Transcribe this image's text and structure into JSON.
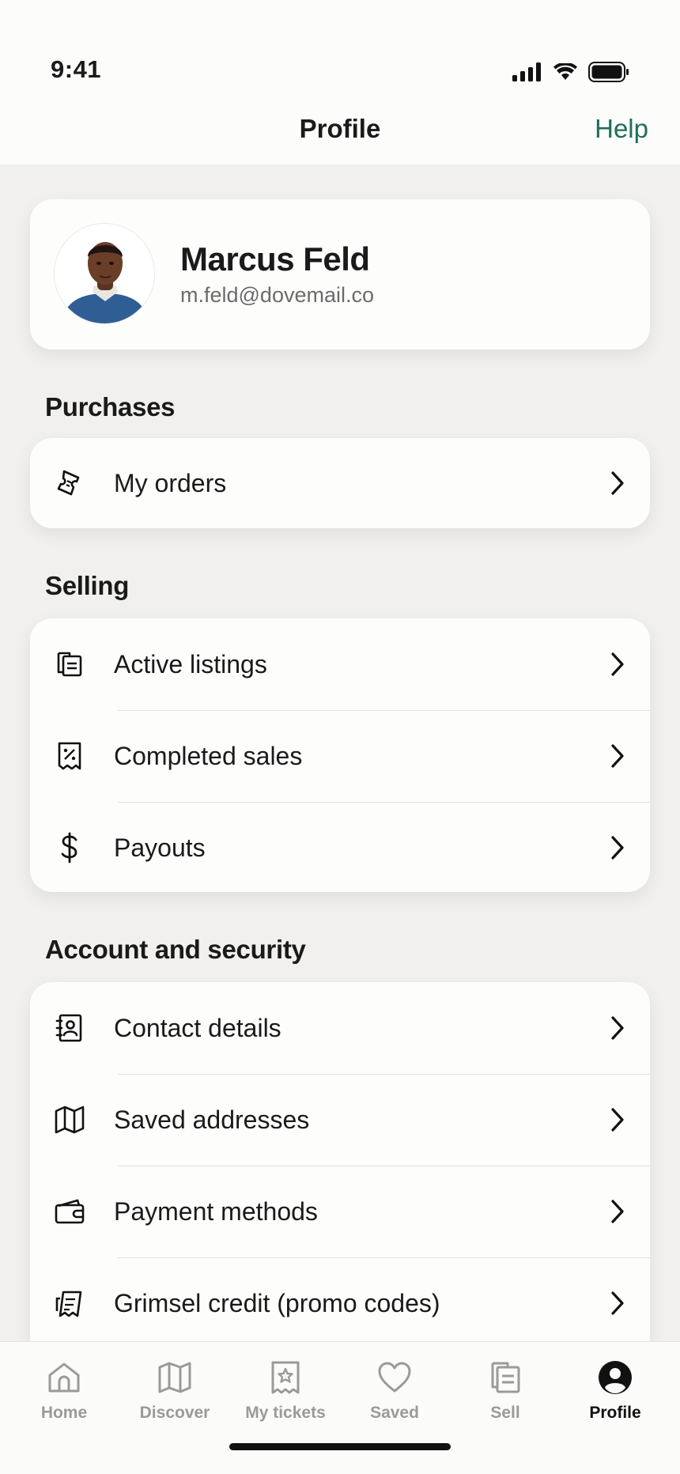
{
  "status_bar": {
    "time": "9:41"
  },
  "nav": {
    "title": "Profile",
    "help_label": "Help"
  },
  "profile": {
    "name": "Marcus Feld",
    "email": "m.feld@dovemail.co"
  },
  "sections": {
    "purchases": {
      "title": "Purchases",
      "items": [
        {
          "label": "My orders",
          "icon": "ticket-icon"
        }
      ]
    },
    "selling": {
      "title": "Selling",
      "items": [
        {
          "label": "Active listings",
          "icon": "listings-icon"
        },
        {
          "label": "Completed sales",
          "icon": "receipt-icon"
        },
        {
          "label": "Payouts",
          "icon": "dollar-icon"
        }
      ]
    },
    "account": {
      "title": "Account and security",
      "items": [
        {
          "label": "Contact details",
          "icon": "contact-card-icon"
        },
        {
          "label": "Saved addresses",
          "icon": "map-icon"
        },
        {
          "label": "Payment methods",
          "icon": "wallet-icon"
        },
        {
          "label": "Grimsel credit (promo codes)",
          "icon": "promo-ticket-icon"
        }
      ]
    }
  },
  "tabbar": {
    "active": "Profile",
    "tabs": [
      {
        "label": "Home",
        "icon": "home-icon"
      },
      {
        "label": "Discover",
        "icon": "map-icon"
      },
      {
        "label": "My tickets",
        "icon": "ticket-star-icon"
      },
      {
        "label": "Saved",
        "icon": "heart-icon"
      },
      {
        "label": "Sell",
        "icon": "listings-icon"
      },
      {
        "label": "Profile",
        "icon": "profile-icon"
      }
    ]
  },
  "colors": {
    "accent": "#1f6e5a",
    "background": "#f1f0ee",
    "card": "#fdfdfc",
    "inactive_tab": "#9a9a98"
  }
}
